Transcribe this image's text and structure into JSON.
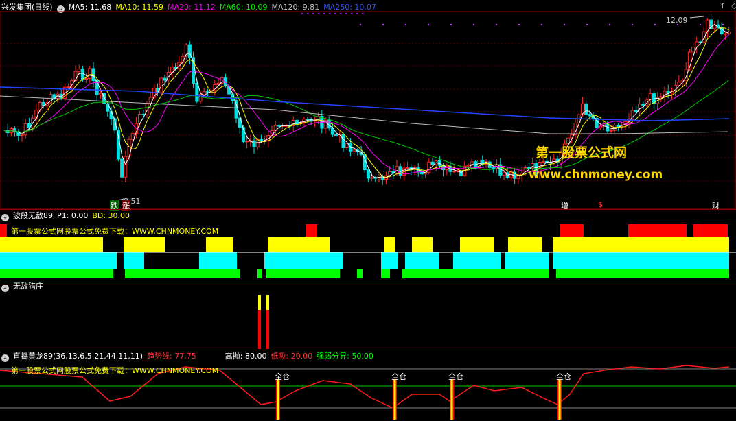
{
  "header": {
    "stock_title": "兴发集团(日线)",
    "ma": [
      {
        "label": "MA5: 11.68",
        "color": "#ffffff"
      },
      {
        "label": "MA10: 11.59",
        "color": "#ffff00"
      },
      {
        "label": "MA20: 11.12",
        "color": "#ff00ff"
      },
      {
        "label": "MA60: 10.09",
        "color": "#00ff00"
      },
      {
        "label": "MA120: 9.81",
        "color": "#c0c0c0"
      },
      {
        "label": "MA250: 10.07",
        "color": "#3355ff"
      }
    ]
  },
  "price_panel": {
    "high_label": "12.09",
    "low_label": "8.51",
    "signals": [
      {
        "text": "跌",
        "color": "#ffffff",
        "bg": "#008800"
      },
      {
        "text": "涨",
        "color": "#ffffff",
        "bg": "#880000"
      },
      {
        "text": "增",
        "color": "#ffffff",
        "bg": ""
      },
      {
        "text": "$",
        "color": "#ff3333",
        "bg": ""
      },
      {
        "text": "财",
        "color": "#ffffff",
        "bg": ""
      }
    ],
    "watermark_title": "第一股票公式网",
    "watermark_url": "www.chnmoney.com"
  },
  "panel2": {
    "title": "波段无敌89",
    "p1": "P1: 0.00",
    "bd": "BD: 30.00",
    "watermark": "第一股票公式网股票公式免费下载：WWW.CHNMONEY.COM"
  },
  "panel3": {
    "title": "无敌猎庄"
  },
  "panel4": {
    "title": "直捣黄龙89(36,13,6,5,21,44,11,11)",
    "trend_label": "趋势线: 77.75",
    "high_label": "高抛: 80.00",
    "low_label": "低吸: 20.00",
    "boundary_label": "强弱分界: 50.00",
    "watermark": "第一股票公式网股票公式免费下载：WWW.CHNMONEY.COM",
    "signal_text": "全仓"
  },
  "chart_data": {
    "type": "line",
    "y_range_visible": [
      8.51,
      12.09
    ],
    "moving_averages": [
      {
        "name": "MA5",
        "last": 11.68
      },
      {
        "name": "MA10",
        "last": 11.59
      },
      {
        "name": "MA20",
        "last": 11.12
      },
      {
        "name": "MA60",
        "last": 10.09
      },
      {
        "name": "MA120",
        "last": 9.81
      },
      {
        "name": "MA250",
        "last": 10.07
      }
    ],
    "oscillator": {
      "trend_last": 77.75,
      "high_line": 80,
      "low_line": 20,
      "boundary": 50,
      "y_range": [
        0,
        100
      ]
    }
  },
  "colors": {
    "up": "#ff2828",
    "down": "#00e0e0",
    "band_red": "#ff0000",
    "band_yellow": "#ffff00",
    "band_cyan": "#00ffff",
    "band_green": "#00ff00",
    "grid": "#8b0000"
  }
}
